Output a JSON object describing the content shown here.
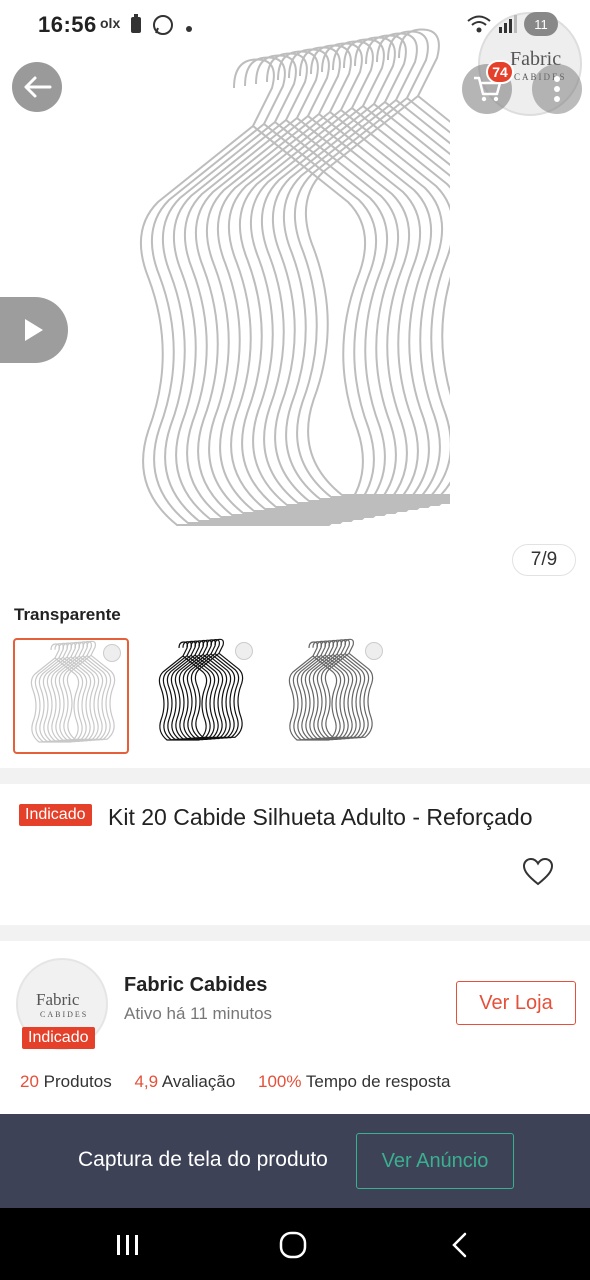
{
  "status_bar": {
    "time": "16:56",
    "olx_label": "olx",
    "notification_count": "11"
  },
  "hero": {
    "page_indicator": "7/9",
    "cart_badge": "74",
    "store_logo_top": {
      "name": "Fabric",
      "sub": "CABIDES"
    }
  },
  "variation": {
    "label": "Transparente",
    "options": [
      {
        "name": "transparente",
        "color": "#cfcfcf",
        "selected": true
      },
      {
        "name": "preto",
        "color": "#111111",
        "selected": false
      },
      {
        "name": "cinza",
        "color": "#6a6a6a",
        "selected": false
      }
    ]
  },
  "product": {
    "badge": "Indicado",
    "title": "Kit 20 Cabide Silhueta Adulto - Reforçado"
  },
  "store": {
    "logo": {
      "name": "Fabric",
      "sub": "CABIDES"
    },
    "badge": "Indicado",
    "name": "Fabric Cabides",
    "active": "Ativo há 11 minutos",
    "ver_loja": "Ver Loja",
    "stats": {
      "products_value": "20",
      "products_label": "Produtos",
      "rating_value": "4,9",
      "rating_label": "Avaliação",
      "response_value": "100%",
      "response_label": "Tempo de resposta"
    }
  },
  "banner": {
    "text": "Captura de tela do produto",
    "button": "Ver Anúncio"
  },
  "colors": {
    "accent": "#e5503a",
    "badge": "#e5402a",
    "banner_bg": "#3e4257",
    "banner_button": "#39b08f"
  }
}
